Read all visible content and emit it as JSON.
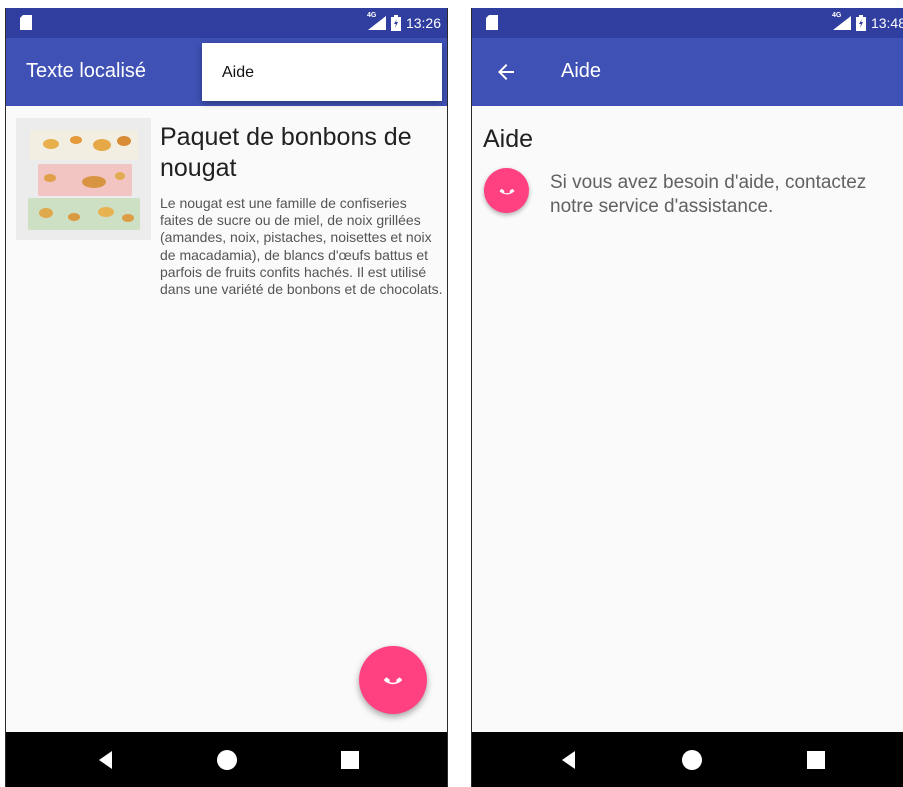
{
  "left_screen": {
    "status": {
      "time": "13:26",
      "network": "4G"
    },
    "app_bar": {
      "title": "Texte localisé"
    },
    "menu": {
      "items": [
        {
          "label": "Aide"
        }
      ]
    },
    "product": {
      "title": "Paquet de bonbons de nougat",
      "description": "Le nougat est une famille de confiseries faites de sucre ou de miel, de noix grillées (amandes, noix, pistaches, noisettes et noix de macadamia), de blancs d'œufs battus et parfois de fruits confits hachés. Il est utilisé dans une variété de bonbons et de chocolats.",
      "image": "nougat-candy-photo"
    },
    "fab": {
      "icon": "phone-icon"
    }
  },
  "right_screen": {
    "status": {
      "time": "13:48",
      "network": "4G"
    },
    "app_bar": {
      "title": "Aide",
      "back_icon": "arrow-back-icon"
    },
    "heading": "Aide",
    "help_text": "Si vous avez besoin d'aide, contactez notre service d'assistance.",
    "call_icon": "phone-icon"
  },
  "navigation": {
    "buttons": [
      "back-triangle-icon",
      "home-circle-icon",
      "recents-square-icon"
    ]
  },
  "colors": {
    "primary": "#3f51b5",
    "primary_dark": "#303f9f",
    "accent": "#ff4081",
    "background": "#fafafa"
  }
}
